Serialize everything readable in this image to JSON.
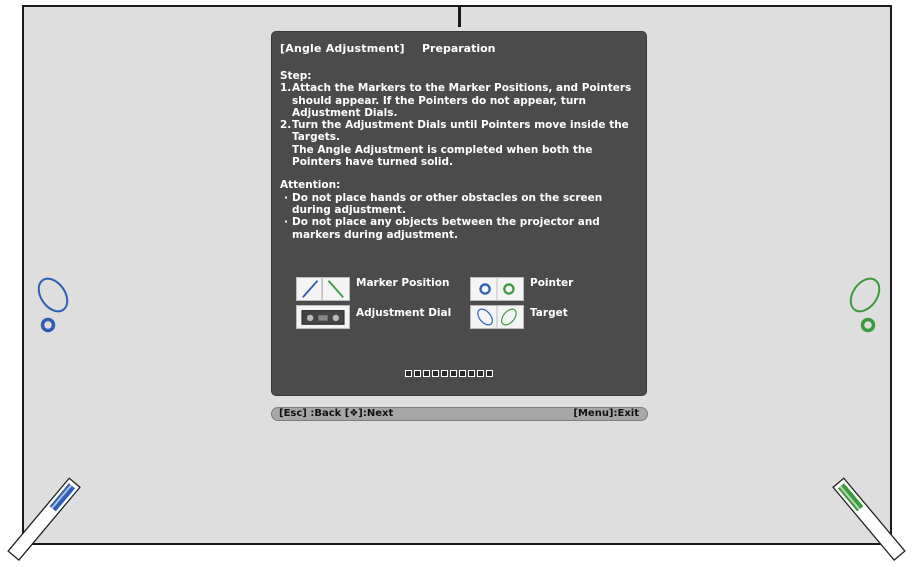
{
  "dialog": {
    "title": "[Angle Adjustment]",
    "subtitle": "Preparation",
    "step_heading": "Step:",
    "steps": [
      {
        "num": "1.",
        "text": "Attach the Markers to the Marker Positions, and Pointers should appear. If the Pointers do not appear, turn Adjustment Dials."
      },
      {
        "num": "2.",
        "text": "Turn the Adjustment Dials until Pointers move inside the Targets.\nThe Angle Adjustment is completed when both the Pointers have turned solid."
      }
    ],
    "attention_heading": "Attention:",
    "attention_items": [
      "Do not place hands or other obstacles on the screen during adjustment.",
      "Do not place any objects between the projector and markers during adjustment."
    ],
    "legend": {
      "marker_position": "Marker Position",
      "adjustment_dial": "Adjustment Dial",
      "pointer": "Pointer",
      "target": "Target"
    },
    "progress": {
      "total": 10,
      "completed": 0
    }
  },
  "helpbar": {
    "left": "[Esc] :Back  [❖]:Next",
    "right": "[Menu]:Exit"
  },
  "colors": {
    "left_marker": "#2f5fb5",
    "right_marker": "#3e9a3e",
    "dialog_bg": "#4b4b4b",
    "screen_bg": "#dedede"
  }
}
